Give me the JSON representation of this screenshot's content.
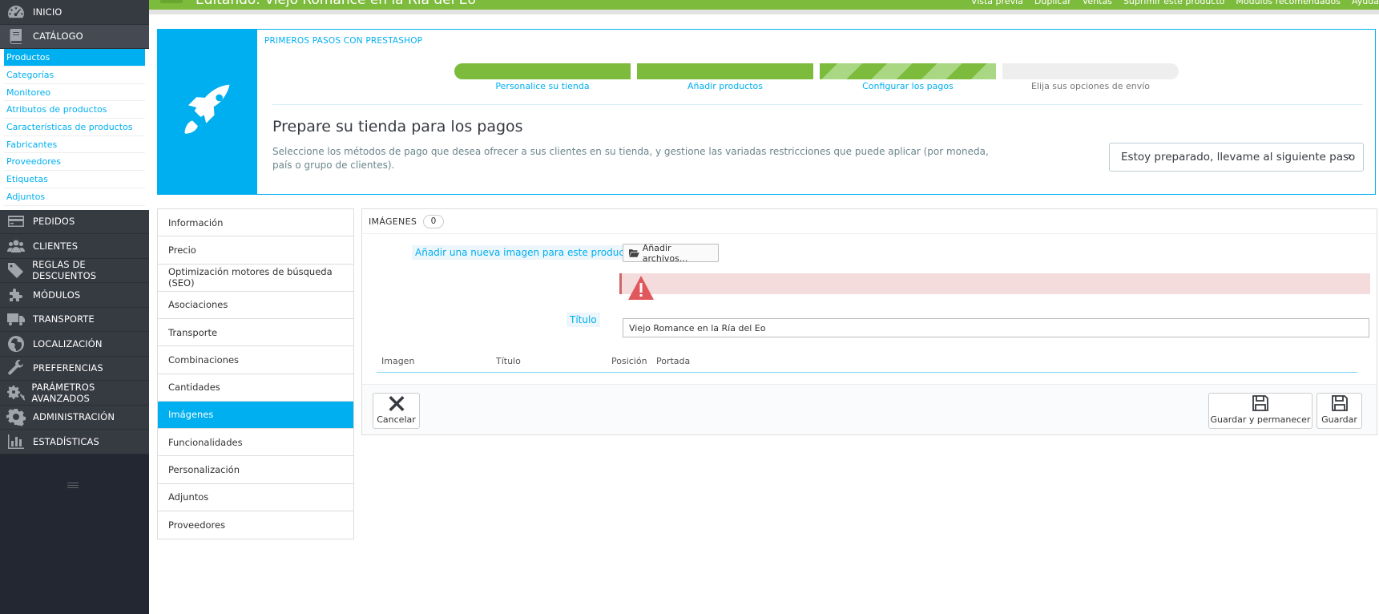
{
  "header": {
    "title": "Editando: Viejo Romance en la Ría del Eo",
    "links": [
      "Vista previa",
      "Duplicar",
      "Ventas",
      "Suprimir este producto",
      "Módulos recomendados",
      "Ayuda"
    ]
  },
  "sidebar": {
    "items_top": [
      {
        "label": "INICIO",
        "icon": "dashboard-icon"
      },
      {
        "label": "CATÁLOGO",
        "icon": "book-icon"
      }
    ],
    "catalog_sub": [
      "Productos",
      "Categorías",
      "Monitoreo",
      "Atributos de productos",
      "Características de productos",
      "Fabricantes",
      "Proveedores",
      "Etiquetas",
      "Adjuntos"
    ],
    "items_bottom": [
      {
        "label": "PEDIDOS",
        "icon": "credit-card-icon"
      },
      {
        "label": "CLIENTES",
        "icon": "users-icon"
      },
      {
        "label": "REGLAS DE DESCUENTOS",
        "icon": "tags-icon"
      },
      {
        "label": "MÓDULOS",
        "icon": "puzzle-icon"
      },
      {
        "label": "TRANSPORTE",
        "icon": "truck-icon"
      },
      {
        "label": "LOCALIZACIÓN",
        "icon": "globe-icon"
      },
      {
        "label": "PREFERENCIAS",
        "icon": "wrench-icon"
      },
      {
        "label": "PARÁMETROS AVANZADOS",
        "icon": "cogs-icon"
      },
      {
        "label": "ADMINISTRACIÓN",
        "icon": "gear-icon"
      },
      {
        "label": "ESTADÍSTICAS",
        "icon": "bar-chart-icon"
      }
    ]
  },
  "onboarding": {
    "heading": "PRIMEROS PASOS CON PRESTASHOP",
    "steps": [
      "Personalice su tienda",
      "Añadir productos",
      "Configurar los pagos",
      "Elija sus opciones de envío"
    ],
    "title": "Prepare su tienda para los pagos",
    "description": "Seleccione los métodos de pago que desea ofrecer a sus clientes en su tienda, y gestione las variadas restricciones que puede aplicar (por moneda, país o grupo de clientes).",
    "button": "Estoy preparado, llevame al siguiente paso"
  },
  "tabs": [
    "Información",
    "Precio",
    "Optimización motores de búsqueda (SEO)",
    "Asociaciones",
    "Transporte",
    "Combinaciones",
    "Cantidades",
    "Imágenes",
    "Funcionalidades",
    "Personalización",
    "Adjuntos",
    "Proveedores"
  ],
  "images_panel": {
    "heading": "IMÁGENES",
    "count": "0",
    "add_label": "Añadir una nueva imagen para este producto",
    "add_button": "Añadir archivos...",
    "title_label": "Título",
    "title_value": "Viejo Romance en la Ría del Eo",
    "columns": [
      "Imagen",
      "Título",
      "Posición",
      "Portada"
    ],
    "cancel": "Cancelar",
    "save_stay": "Guardar y permanecer",
    "save": "Guardar"
  }
}
